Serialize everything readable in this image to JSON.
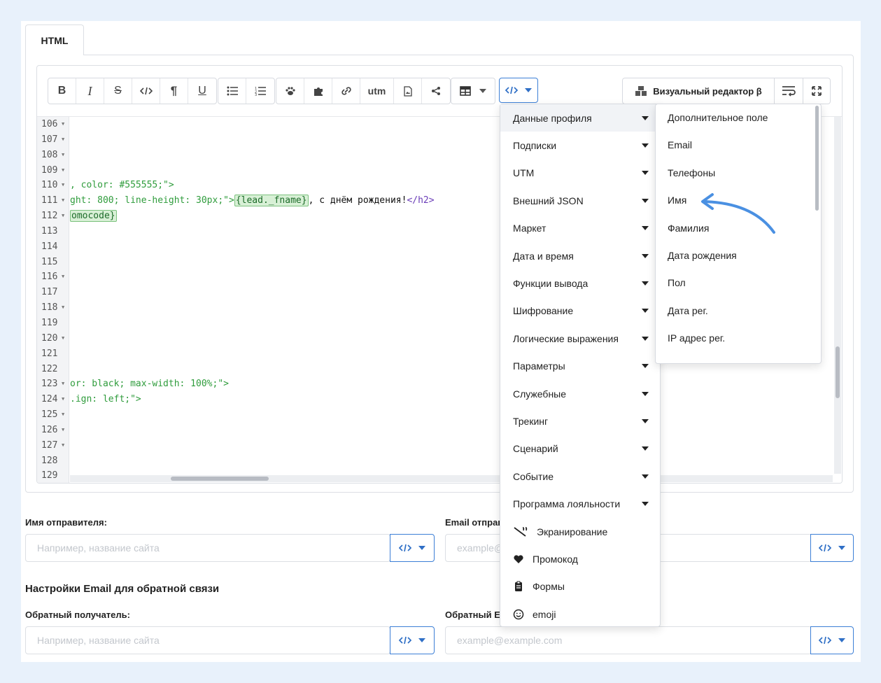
{
  "tab": {
    "label": "HTML"
  },
  "toolbar": {
    "utm_label": "utm",
    "visual_editor_label": "Визуальный редактор β"
  },
  "editor": {
    "line_numbers": [
      "106",
      "107",
      "108",
      "109",
      "110",
      "111",
      "112",
      "113",
      "114",
      "115",
      "116",
      "117",
      "118",
      "119",
      "120",
      "121",
      "122",
      "123",
      "124",
      "125",
      "126",
      "127",
      "128",
      "129"
    ],
    "line_110": ", color: #555555;\">",
    "line_111_a": "ght: 800; line-height: 30px;\">",
    "line_111_token": "{lead._fname}",
    "line_111_b": ", с днём рождения!",
    "line_111_tag": "</h2>",
    "line_112_token": "omocode}",
    "line_123": "or: black; max-width: 100%;\">",
    "line_124": ".ign: left;\">"
  },
  "insert_menu": {
    "items": [
      {
        "label": "Данные профиля",
        "submenu": true
      },
      {
        "label": "Подписки",
        "submenu": true
      },
      {
        "label": "UTM",
        "submenu": true
      },
      {
        "label": "Внешний JSON",
        "submenu": true
      },
      {
        "label": "Маркет",
        "submenu": true
      },
      {
        "label": "Дата и время",
        "submenu": true
      },
      {
        "label": "Функции вывода",
        "submenu": true
      },
      {
        "label": "Шифрование",
        "submenu": true
      },
      {
        "label": "Логические выражения",
        "submenu": true
      },
      {
        "label": "Параметры",
        "submenu": true
      },
      {
        "label": "Служебные",
        "submenu": true
      },
      {
        "label": "Трекинг",
        "submenu": true
      },
      {
        "label": "Сценарий",
        "submenu": true
      },
      {
        "label": "Событие",
        "submenu": true
      },
      {
        "label": "Программа лояльности",
        "submenu": true
      }
    ],
    "icon_items": [
      {
        "label": "Экранирование",
        "icon": "escape-quote-icon"
      },
      {
        "label": "Промокод",
        "icon": "heart-icon"
      },
      {
        "label": "Формы",
        "icon": "clipboard-icon"
      },
      {
        "label": "emoji",
        "icon": "smile-icon"
      }
    ]
  },
  "profile_submenu": {
    "items": [
      "Дополнительное поле",
      "Email",
      "Телефоны",
      "Имя",
      "Фамилия",
      "Дата рождения",
      "Пол",
      "Дата рег.",
      "IP адрес рег."
    ]
  },
  "sender": {
    "name_label": "Имя отправителя:",
    "name_placeholder": "Например, название сайта",
    "email_label": "Email отправ",
    "email_placeholder": "example@"
  },
  "feedback": {
    "section_title": "Настройки Email для обратной связи",
    "recipient_label": "Обратный получатель:",
    "recipient_placeholder": "Например, название сайта",
    "email_label": "Обратный Em",
    "email_placeholder": "example@example.com"
  },
  "colors": {
    "accent": "#3c7fd6",
    "highlight_arrow": "#4a90e2",
    "code_green": "#2f9c3c"
  }
}
